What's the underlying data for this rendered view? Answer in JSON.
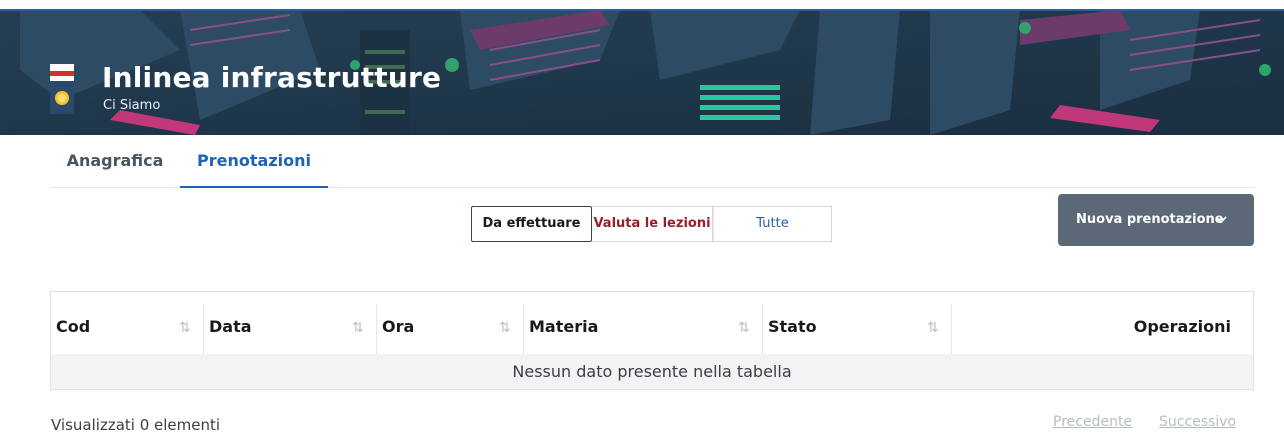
{
  "header": {
    "title": "Inlinea infrastrutture",
    "subtitle": "Ci Siamo",
    "logo_icon": "coat-of-arms-icon"
  },
  "tabs": [
    {
      "label": "Anagrafica",
      "active": false
    },
    {
      "label": "Prenotazioni",
      "active": true
    }
  ],
  "filters": [
    {
      "label": "Da effettuare",
      "selected": true
    },
    {
      "label": "Valuta le lezioni",
      "selected": false
    },
    {
      "label": "Tutte",
      "selected": false
    }
  ],
  "new_button": {
    "label": "Nuova prenotazione",
    "icon": "chevron-down-icon"
  },
  "table": {
    "columns": [
      "Cod",
      "Data",
      "Ora",
      "Materia",
      "Stato",
      "Operazioni"
    ],
    "sort_icon": "⇅",
    "empty_message": "Nessun dato presente nella tabella"
  },
  "footer": {
    "info": "Visualizzati 0 elementi",
    "prev": "Precedente",
    "next": "Successivo"
  },
  "colors": {
    "accent": "#1f63b5",
    "banner": "#1f3a4d",
    "button": "#5b6877",
    "danger": "#9b1c2c"
  }
}
